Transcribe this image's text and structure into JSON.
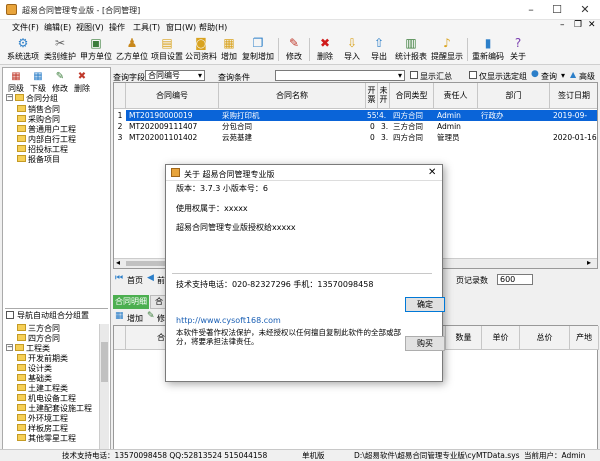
{
  "window": {
    "title": "超易合同管理专业版 - [合同管理]",
    "icons": {
      "minimize": "minimize-icon",
      "maximize": "maximize-icon",
      "close": "close-icon"
    }
  },
  "menu": [
    "文件(F)",
    "编辑(E)",
    "视图(V)",
    "操作",
    "工具(T)",
    "窗口(W)",
    "帮助(H)"
  ],
  "toolbar": [
    {
      "label": "系统选项",
      "icon": "gear-icon"
    },
    {
      "label": "类别维护",
      "icon": "tools-icon"
    },
    {
      "label": "甲方单位",
      "icon": "building-icon"
    },
    {
      "label": "乙方单位",
      "icon": "users-icon"
    },
    {
      "label": "项目设置",
      "icon": "folder-icon"
    },
    {
      "label": "公司资料",
      "icon": "briefcase-icon"
    },
    {
      "label": "增加",
      "icon": "add-doc-icon"
    },
    {
      "label": "复制增加",
      "icon": "copy-icon"
    },
    {
      "label": "修改",
      "icon": "edit-icon"
    },
    {
      "label": "删除",
      "icon": "delete-icon"
    },
    {
      "label": "导入",
      "icon": "import-icon"
    },
    {
      "label": "导出",
      "icon": "export-icon"
    },
    {
      "label": "统计报表",
      "icon": "chart-icon"
    },
    {
      "label": "提醒显示",
      "icon": "bell-icon"
    },
    {
      "label": "重新编码",
      "icon": "barcode-icon"
    },
    {
      "label": "关于",
      "icon": "help-icon"
    }
  ],
  "left": {
    "buttons": [
      "同级",
      "下级",
      "修改",
      "删除"
    ],
    "tree": [
      {
        "label": "合同分组",
        "level": 0,
        "expand": "-"
      },
      {
        "label": "销售合同",
        "level": 1
      },
      {
        "label": "采购合同",
        "level": 1
      },
      {
        "label": "普通用户工程",
        "level": 1
      },
      {
        "label": "内部自行工程",
        "level": 1
      },
      {
        "label": "招投标工程",
        "level": 1
      },
      {
        "label": "报备项目",
        "level": 1
      }
    ],
    "auto_group_label": "导航自动组合分组置",
    "tree2": [
      {
        "label": "三方合同",
        "level": 1
      },
      {
        "label": "四方合同",
        "level": 1
      },
      {
        "label": "工程类",
        "level": 0,
        "expand": "-"
      },
      {
        "label": "开发前期类",
        "level": 1
      },
      {
        "label": "设计类",
        "level": 1
      },
      {
        "label": "基础类",
        "level": 1
      },
      {
        "label": "土建工程类",
        "level": 1
      },
      {
        "label": "机电设备工程",
        "level": 1
      },
      {
        "label": "土建配套设施工程",
        "level": 1
      },
      {
        "label": "外环境工程",
        "level": 1
      },
      {
        "label": "样板房工程",
        "level": 1
      },
      {
        "label": "其他零星工程",
        "level": 1
      }
    ]
  },
  "search": {
    "field_label": "查询字段",
    "field_value": "合同编号",
    "cond_label": "查询条件",
    "cond_value": "",
    "show_summary": "显示汇总",
    "show_only_selected": "仅显示选定组",
    "query_btn": "查询",
    "advanced": "高级"
  },
  "grid": {
    "headers": [
      "合同编号",
      "合同名称",
      "开票",
      "未开",
      "合同类型",
      "责任人",
      "部门",
      "签订日期"
    ],
    "rows": [
      {
        "idx": "1",
        "code": "MT20190000019",
        "name": "采购打印机",
        "a": "555",
        "b": "4.",
        "type": "四方合同",
        "owner": "Admin",
        "dept": "行政办",
        "date": "2019-09-"
      },
      {
        "idx": "2",
        "code": "MT202009111407",
        "name": "分包合同",
        "a": "0",
        "b": "3.",
        "type": "三方合同",
        "owner": "Admin",
        "dept": "",
        "date": ""
      },
      {
        "idx": "3",
        "code": "MT202001101402",
        "name": "云苑基建",
        "a": "0",
        "b": "3.",
        "type": "四方合同",
        "owner": "管理员",
        "dept": "",
        "date": "2020-01-16"
      }
    ]
  },
  "nav": {
    "first": "首页",
    "prev": "前",
    "page_size_label": "页记录数",
    "page_size": "600"
  },
  "bottom": {
    "tabs": [
      "合同明细",
      "合"
    ],
    "add": "增加",
    "edit": "修",
    "headers": [
      "合同编号",
      "数量",
      "单价",
      "总价",
      "产地"
    ]
  },
  "dialog": {
    "title": "关于 超易合同管理专业版",
    "version": "版本：3.7.3 小版本号：6",
    "licensed_to": "使用权属于：xxxxx",
    "licensed_name": "超易合同管理专业版授权给xxxxx",
    "support": "技术支持电话：020-82327296  手机：13570098458",
    "url": "http://www.cysoft168.com",
    "copyright": "本软件受著作权法保护，未经授权以任何擅自复制此软件的全部或部分，将要承担法律责任。",
    "ok": "确定",
    "buy": "购买",
    "company": "cysoft168.com"
  },
  "status": {
    "phone": "技术支持电话：13570098458 QQ:52813524 515044158",
    "mode": "单机版",
    "path": "D:\\超易软件\\超易合同管理专业版\\cyMTData.sys",
    "user": "当前用户：Admin"
  }
}
